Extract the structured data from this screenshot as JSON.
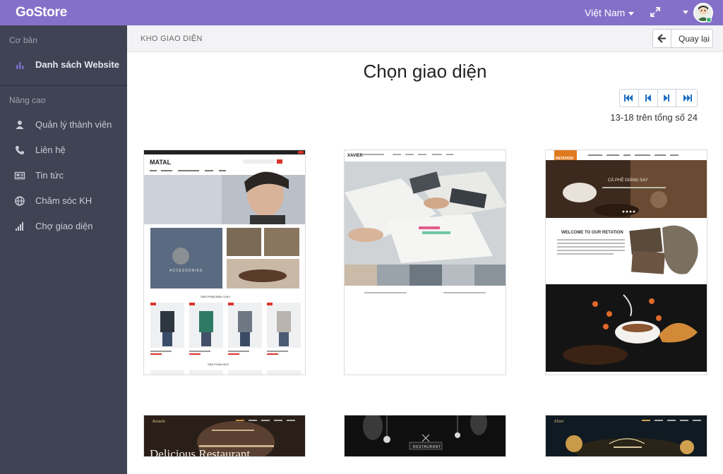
{
  "app": {
    "brand": "GoStore"
  },
  "topbar": {
    "language": "Việt Nam"
  },
  "sidebar": {
    "section_basic": "Cơ bản",
    "section_advanced": "Nâng cao",
    "items": [
      {
        "label": "Danh sách Website",
        "icon": "bar-chart-icon",
        "active": true
      },
      {
        "label": "Quản lý thành viên",
        "icon": "user-icon"
      },
      {
        "label": "Liên hệ",
        "icon": "phone-icon"
      },
      {
        "label": "Tin tức",
        "icon": "newspaper-icon"
      },
      {
        "label": "Chăm sóc KH",
        "icon": "globe-icon"
      },
      {
        "label": "Chợ giao diện",
        "icon": "signal-icon"
      }
    ]
  },
  "header": {
    "breadcrumb": "KHO GIAO DIỆN",
    "back_label": "Quay lại"
  },
  "main": {
    "title": "Chọn giao diện",
    "pagination_info": "13-18 trên tổng số 24",
    "themes": [
      {
        "name": "MATAL",
        "caption": "ACCESSORIES",
        "section1": "SẢN PHẨM BÁN CHẠY",
        "section2": "SẢN PHẨM MỚI"
      },
      {
        "name": "XAVIER"
      },
      {
        "name": "RETATION",
        "caption": "WELCOME TO OUR RETATION",
        "slide": "CÀ PHÊ GIẢNG SAY"
      },
      {
        "name": "Kestelo",
        "caption": "Delicious Restaurant"
      },
      {
        "name": "RESTAURANT"
      },
      {
        "name": "Elixir"
      }
    ]
  },
  "colors": {
    "topbar": "#8470c8",
    "sidebar": "#3f4354",
    "accent": "#1e6fc3"
  }
}
